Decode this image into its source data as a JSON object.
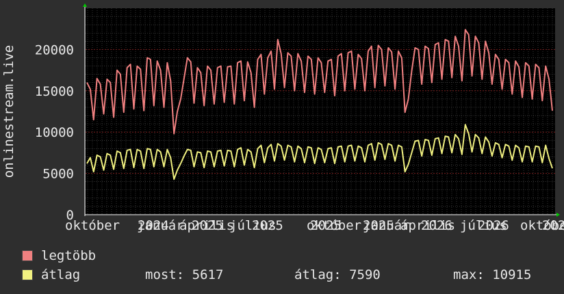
{
  "chart_data": {
    "type": "line",
    "ylabel": "onlinestream.live",
    "ylim": [
      0,
      25000
    ],
    "yticks": [
      "0",
      "5000",
      "10000",
      "15000",
      "20000"
    ],
    "xtick_labels": [
      "október",
      "január",
      "2024",
      "április",
      "2025",
      "július",
      "2025",
      "október",
      "2025",
      "január",
      "2025",
      "április",
      "2026",
      "július",
      "2026",
      "október",
      "2026"
    ],
    "grid": true,
    "colors": {
      "background": "#2e2e2e",
      "plot": "#000000",
      "grid": "#5a5a5a",
      "grid_major": "#7a1f1f",
      "axis": "#ffffff",
      "arrow": "#00cc00",
      "series_max": "#f08080",
      "series_avg": "#f0f080"
    },
    "series": [
      {
        "name": "legtöbb",
        "color": "#f08080",
        "values": [
          16000,
          15200,
          11500,
          16500,
          15800,
          12200,
          16400,
          16000,
          11800,
          17500,
          17000,
          12400,
          17800,
          18200,
          12800,
          18000,
          17600,
          12600,
          19000,
          18800,
          13200,
          18600,
          17500,
          13000,
          18400,
          16200,
          9800,
          12500,
          14000,
          16500,
          19000,
          18500,
          13500,
          17800,
          17200,
          13200,
          18000,
          17500,
          13400,
          17800,
          18000,
          13600,
          17900,
          18000,
          13400,
          18400,
          18600,
          13800,
          18500,
          17200,
          13000,
          18800,
          19400,
          14600,
          19000,
          19800,
          15200,
          21200,
          19500,
          15400,
          19600,
          19200,
          15000,
          19500,
          18600,
          14800,
          19200,
          18800,
          14600,
          19000,
          18400,
          14800,
          18600,
          18800,
          14400,
          19200,
          19500,
          15000,
          19600,
          19800,
          15200,
          19400,
          18900,
          15000,
          19800,
          20400,
          15400,
          20500,
          20000,
          15600,
          20200,
          19700,
          15200,
          19800,
          19000,
          12400,
          14000,
          17400,
          20200,
          20000,
          15800,
          20400,
          20100,
          16000,
          20600,
          20800,
          16400,
          21200,
          21000,
          16600,
          21600,
          20400,
          16200,
          22400,
          21800,
          16800,
          21600,
          20800,
          16400,
          21000,
          19600,
          15800,
          19400,
          18800,
          15200,
          18800,
          18400,
          14600,
          18600,
          17900,
          14200,
          18400,
          18000,
          14000,
          18200,
          17800,
          13800,
          18000,
          16400,
          12600
        ]
      },
      {
        "name": "átlag",
        "color": "#f0f080",
        "values": [
          6200,
          6900,
          5200,
          7200,
          7000,
          5400,
          7400,
          7200,
          5500,
          7700,
          7500,
          5600,
          7800,
          7900,
          5700,
          7900,
          7700,
          5600,
          8000,
          7900,
          5800,
          7900,
          7600,
          5800,
          7900,
          6900,
          4300,
          5400,
          6200,
          7100,
          7900,
          7800,
          5800,
          7600,
          7500,
          5700,
          7700,
          7600,
          5800,
          7700,
          7800,
          5900,
          7800,
          7700,
          5800,
          7900,
          8100,
          6000,
          7900,
          7600,
          5700,
          8000,
          8400,
          6300,
          8100,
          8500,
          6500,
          8600,
          8300,
          6600,
          8400,
          8200,
          6400,
          8300,
          8000,
          6300,
          8200,
          8100,
          6200,
          8100,
          7900,
          6300,
          8000,
          8100,
          6200,
          8200,
          8300,
          6400,
          8300,
          8400,
          6500,
          8300,
          8100,
          6400,
          8400,
          8600,
          6600,
          8700,
          8500,
          6700,
          8600,
          8400,
          6500,
          8400,
          8200,
          5200,
          6100,
          7500,
          8900,
          9000,
          7100,
          9100,
          9000,
          7200,
          9200,
          9300,
          7400,
          9500,
          9400,
          7500,
          9700,
          9200,
          7300,
          10900,
          9800,
          7600,
          9700,
          9300,
          7400,
          9400,
          8800,
          7100,
          8700,
          8500,
          6900,
          8500,
          8300,
          6600,
          8400,
          8100,
          6400,
          8300,
          8200,
          6400,
          8300,
          8200,
          6300,
          8400,
          6800,
          5617
        ]
      }
    ]
  },
  "legend": {
    "max_label": "legtöbb",
    "avg_label": "átlag",
    "stats": {
      "most": "most: 5617",
      "avg": "átlag: 7590",
      "max": "max: 10915"
    }
  }
}
